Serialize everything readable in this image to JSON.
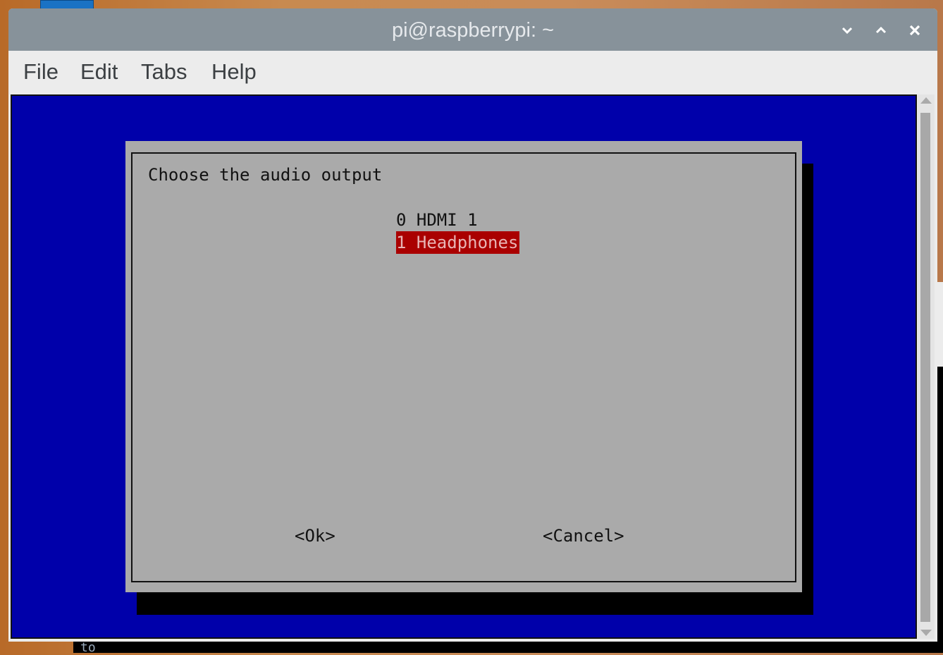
{
  "window": {
    "title": "pi@raspberrypi: ~",
    "controls": [
      "minimize",
      "maximize",
      "close"
    ]
  },
  "menubar": {
    "items": [
      {
        "label": "File"
      },
      {
        "label": "Edit"
      },
      {
        "label": "Tabs"
      },
      {
        "label": "Help"
      }
    ]
  },
  "dialog": {
    "prompt": "Choose the audio output",
    "options": [
      {
        "label": "0 HDMI 1",
        "selected": false
      },
      {
        "label": "1 Headphones",
        "selected": true
      }
    ],
    "ok_label": "<Ok>",
    "cancel_label": "<Cancel>"
  },
  "background_terminal": {
    "partial_text": "to"
  },
  "colors": {
    "terminal_bg": "#0000aa",
    "dialog_bg": "#aaaaaa",
    "selection_bg": "#aa0000",
    "titlebar_bg": "#87929a"
  }
}
